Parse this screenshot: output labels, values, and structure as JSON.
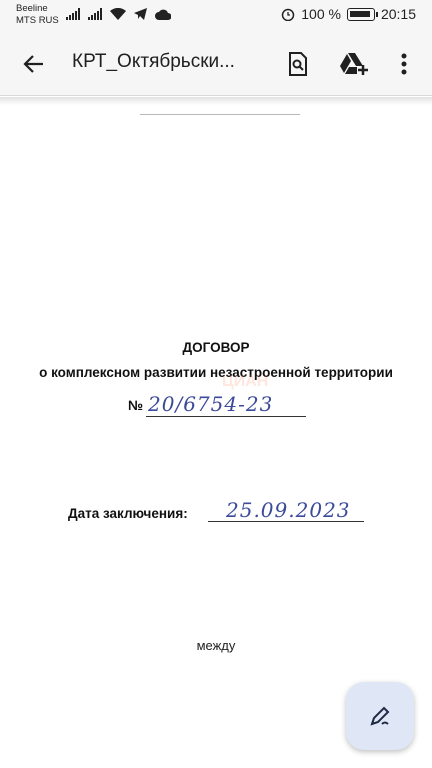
{
  "status_bar": {
    "carrier1": "Beeline",
    "carrier2": "MTS RUS",
    "battery_percent": "100 %",
    "time": "20:15"
  },
  "app_bar": {
    "title": "КРТ_Октябрьски...",
    "back_icon": "arrow-left-icon",
    "search_icon": "find-in-page-icon",
    "drive_icon": "add-to-drive-icon",
    "menu_icon": "more-vert-icon"
  },
  "document": {
    "heading": "ДОГОВОР",
    "subheading": "о комплексном развитии незастроенной территории",
    "number_label": "№",
    "number_value": "20/6754-23",
    "watermark": "ЦИАН",
    "date_label": "Дата заключения:",
    "date_value": "25.09.2023",
    "between": "между"
  },
  "fab": {
    "icon": "edit-pen-icon"
  },
  "colors": {
    "appbar": "#f6f6f6",
    "ink": "#3b4a9a",
    "fab": "#dfe6f6"
  }
}
